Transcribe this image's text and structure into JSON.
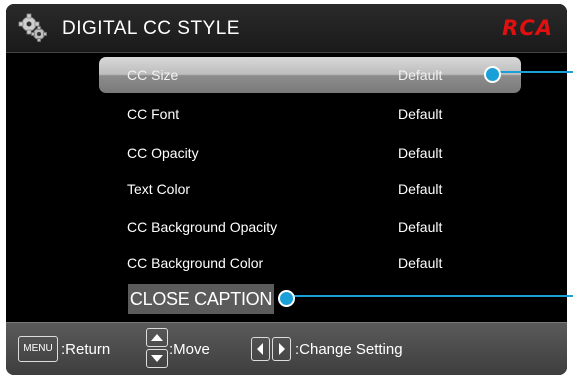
{
  "header": {
    "title": "DIGITAL CC STYLE",
    "brand": "RCA"
  },
  "menu": {
    "items": [
      {
        "label": "CC Size",
        "value": "Default"
      },
      {
        "label": "CC Font",
        "value": "Default"
      },
      {
        "label": "CC Opacity",
        "value": "Default"
      },
      {
        "label": "Text Color",
        "value": "Default"
      },
      {
        "label": "CC Background Opacity",
        "value": "Default"
      },
      {
        "label": "CC Background Color",
        "value": "Default"
      }
    ]
  },
  "caption_tag": "CLOSE CAPTION",
  "footer": {
    "menu_key": "MENU",
    "return_label": ":Return",
    "move_label": ":Move",
    "change_label": ":Change Setting"
  },
  "colors": {
    "accent": "#1aa0d8",
    "brand": "#e01010"
  }
}
